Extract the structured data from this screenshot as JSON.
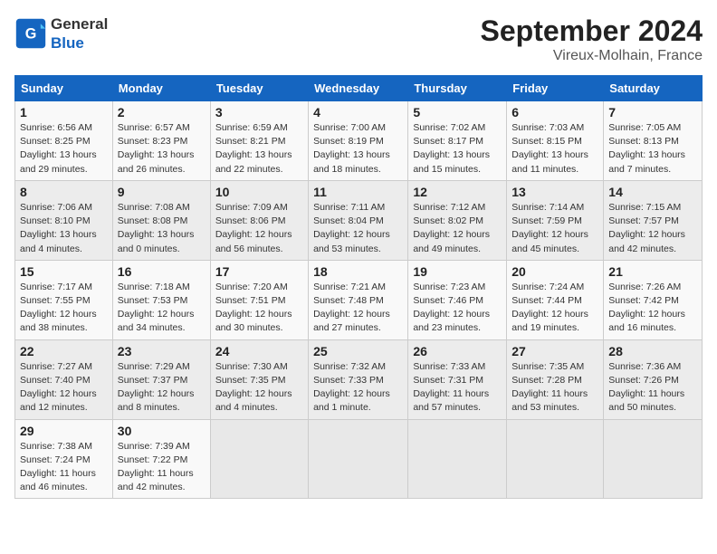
{
  "header": {
    "logo_general": "General",
    "logo_blue": "Blue",
    "month_title": "September 2024",
    "location": "Vireux-Molhain, France"
  },
  "weekdays": [
    "Sunday",
    "Monday",
    "Tuesday",
    "Wednesday",
    "Thursday",
    "Friday",
    "Saturday"
  ],
  "weeks": [
    [
      {
        "day": "1",
        "info": "Sunrise: 6:56 AM\nSunset: 8:25 PM\nDaylight: 13 hours\nand 29 minutes."
      },
      {
        "day": "2",
        "info": "Sunrise: 6:57 AM\nSunset: 8:23 PM\nDaylight: 13 hours\nand 26 minutes."
      },
      {
        "day": "3",
        "info": "Sunrise: 6:59 AM\nSunset: 8:21 PM\nDaylight: 13 hours\nand 22 minutes."
      },
      {
        "day": "4",
        "info": "Sunrise: 7:00 AM\nSunset: 8:19 PM\nDaylight: 13 hours\nand 18 minutes."
      },
      {
        "day": "5",
        "info": "Sunrise: 7:02 AM\nSunset: 8:17 PM\nDaylight: 13 hours\nand 15 minutes."
      },
      {
        "day": "6",
        "info": "Sunrise: 7:03 AM\nSunset: 8:15 PM\nDaylight: 13 hours\nand 11 minutes."
      },
      {
        "day": "7",
        "info": "Sunrise: 7:05 AM\nSunset: 8:13 PM\nDaylight: 13 hours\nand 7 minutes."
      }
    ],
    [
      {
        "day": "8",
        "info": "Sunrise: 7:06 AM\nSunset: 8:10 PM\nDaylight: 13 hours\nand 4 minutes."
      },
      {
        "day": "9",
        "info": "Sunrise: 7:08 AM\nSunset: 8:08 PM\nDaylight: 13 hours\nand 0 minutes."
      },
      {
        "day": "10",
        "info": "Sunrise: 7:09 AM\nSunset: 8:06 PM\nDaylight: 12 hours\nand 56 minutes."
      },
      {
        "day": "11",
        "info": "Sunrise: 7:11 AM\nSunset: 8:04 PM\nDaylight: 12 hours\nand 53 minutes."
      },
      {
        "day": "12",
        "info": "Sunrise: 7:12 AM\nSunset: 8:02 PM\nDaylight: 12 hours\nand 49 minutes."
      },
      {
        "day": "13",
        "info": "Sunrise: 7:14 AM\nSunset: 7:59 PM\nDaylight: 12 hours\nand 45 minutes."
      },
      {
        "day": "14",
        "info": "Sunrise: 7:15 AM\nSunset: 7:57 PM\nDaylight: 12 hours\nand 42 minutes."
      }
    ],
    [
      {
        "day": "15",
        "info": "Sunrise: 7:17 AM\nSunset: 7:55 PM\nDaylight: 12 hours\nand 38 minutes."
      },
      {
        "day": "16",
        "info": "Sunrise: 7:18 AM\nSunset: 7:53 PM\nDaylight: 12 hours\nand 34 minutes."
      },
      {
        "day": "17",
        "info": "Sunrise: 7:20 AM\nSunset: 7:51 PM\nDaylight: 12 hours\nand 30 minutes."
      },
      {
        "day": "18",
        "info": "Sunrise: 7:21 AM\nSunset: 7:48 PM\nDaylight: 12 hours\nand 27 minutes."
      },
      {
        "day": "19",
        "info": "Sunrise: 7:23 AM\nSunset: 7:46 PM\nDaylight: 12 hours\nand 23 minutes."
      },
      {
        "day": "20",
        "info": "Sunrise: 7:24 AM\nSunset: 7:44 PM\nDaylight: 12 hours\nand 19 minutes."
      },
      {
        "day": "21",
        "info": "Sunrise: 7:26 AM\nSunset: 7:42 PM\nDaylight: 12 hours\nand 16 minutes."
      }
    ],
    [
      {
        "day": "22",
        "info": "Sunrise: 7:27 AM\nSunset: 7:40 PM\nDaylight: 12 hours\nand 12 minutes."
      },
      {
        "day": "23",
        "info": "Sunrise: 7:29 AM\nSunset: 7:37 PM\nDaylight: 12 hours\nand 8 minutes."
      },
      {
        "day": "24",
        "info": "Sunrise: 7:30 AM\nSunset: 7:35 PM\nDaylight: 12 hours\nand 4 minutes."
      },
      {
        "day": "25",
        "info": "Sunrise: 7:32 AM\nSunset: 7:33 PM\nDaylight: 12 hours\nand 1 minute."
      },
      {
        "day": "26",
        "info": "Sunrise: 7:33 AM\nSunset: 7:31 PM\nDaylight: 11 hours\nand 57 minutes."
      },
      {
        "day": "27",
        "info": "Sunrise: 7:35 AM\nSunset: 7:28 PM\nDaylight: 11 hours\nand 53 minutes."
      },
      {
        "day": "28",
        "info": "Sunrise: 7:36 AM\nSunset: 7:26 PM\nDaylight: 11 hours\nand 50 minutes."
      }
    ],
    [
      {
        "day": "29",
        "info": "Sunrise: 7:38 AM\nSunset: 7:24 PM\nDaylight: 11 hours\nand 46 minutes."
      },
      {
        "day": "30",
        "info": "Sunrise: 7:39 AM\nSunset: 7:22 PM\nDaylight: 11 hours\nand 42 minutes."
      },
      {
        "day": "",
        "info": ""
      },
      {
        "day": "",
        "info": ""
      },
      {
        "day": "",
        "info": ""
      },
      {
        "day": "",
        "info": ""
      },
      {
        "day": "",
        "info": ""
      }
    ]
  ]
}
